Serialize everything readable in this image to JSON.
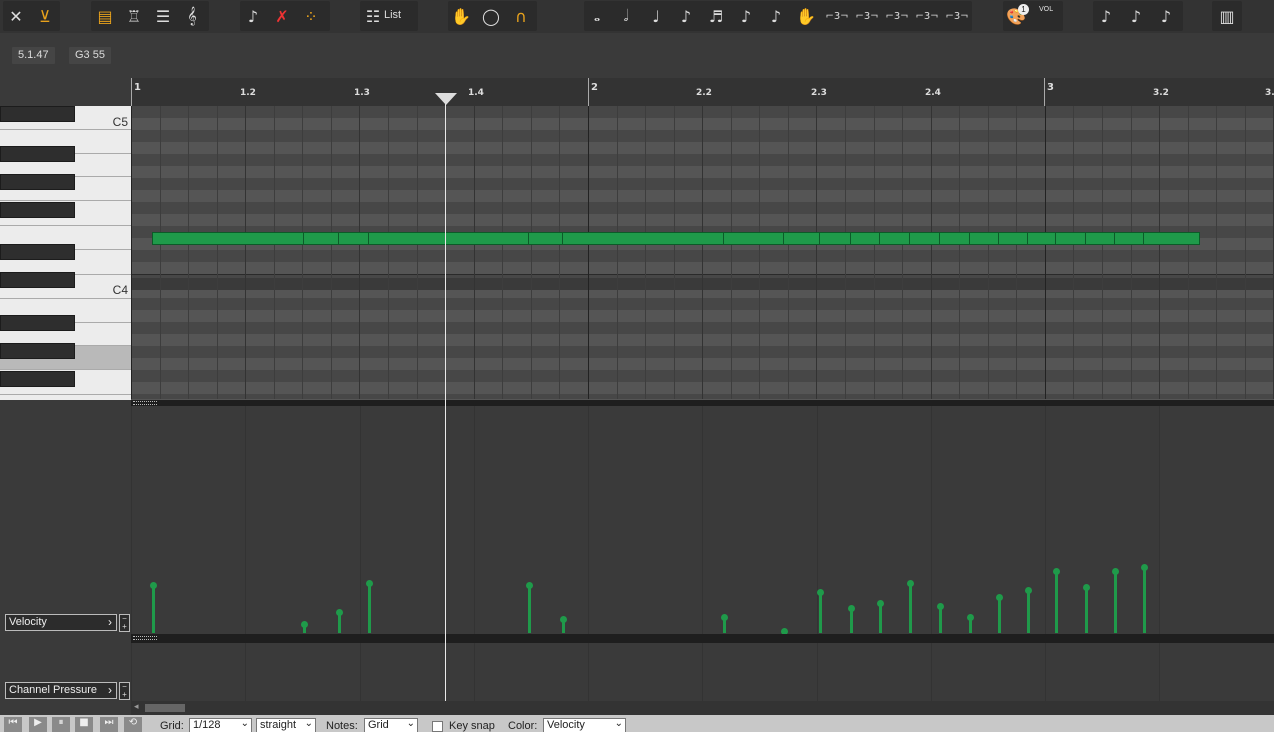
{
  "toolbar": {
    "list_label": "List",
    "icons": [
      "close-icon",
      "import-icon",
      "piano-roll-icon",
      "drum-editor-icon",
      "list-editor-icon",
      "score-editor-icon",
      "curve-icon",
      "curve-delete-icon",
      "dots-icon",
      "list-menu-icon",
      "hand-icon",
      "lasso-icon",
      "magnet-icon",
      "whole-note-icon",
      "half-note-icon",
      "quarter-note-icon",
      "eighth-note-icon",
      "sixteenth-note-icon",
      "thirty-second-note-icon",
      "sixty-fourth-note-icon",
      "grab-icon",
      "triplet-icon",
      "instrument-icon",
      "volume-icon",
      "transpose-down-icon",
      "transpose-icon",
      "transpose-up-icon",
      "keyboard-icon"
    ],
    "palette_badge": "1",
    "vol_label": "VOL",
    "triplet": "⌐3¬"
  },
  "readouts": {
    "position": "5.1.47",
    "pitch": "G3  55"
  },
  "ruler": {
    "ticks": [
      {
        "label": "1",
        "bar": true
      },
      {
        "label": "1.2"
      },
      {
        "label": "1.3"
      },
      {
        "label": "1.4"
      },
      {
        "label": "2",
        "bar": true
      },
      {
        "label": "2.2"
      },
      {
        "label": "2.3"
      },
      {
        "label": "2.4"
      },
      {
        "label": "3",
        "bar": true
      },
      {
        "label": "3.2"
      },
      {
        "label": "3."
      }
    ]
  },
  "keyboard": {
    "c5_label": "C5",
    "c4_label": "C4"
  },
  "lanes": {
    "velocity_label": "Velocity",
    "pressure_label": "Channel Pressure",
    "velocity_fractions": [
      0.21,
      0.04,
      0.09,
      0.22,
      0.21,
      0.06,
      0.07,
      0.01,
      0.18,
      0.11,
      0.13,
      0.22,
      0.12,
      0.07,
      0.16,
      0.19,
      0.27,
      0.2,
      0.27,
      0.29
    ]
  },
  "bottombar": {
    "grid_label": "Grid:",
    "grid_value": "1/128",
    "straight_value": "straight",
    "notes_label": "Notes:",
    "notes_value": "Grid",
    "keysnap_label": "Key snap",
    "color_label": "Color:",
    "color_value": "Velocity"
  },
  "colors": {
    "note": "#1f9a4a",
    "accent": "#e8a21c"
  }
}
